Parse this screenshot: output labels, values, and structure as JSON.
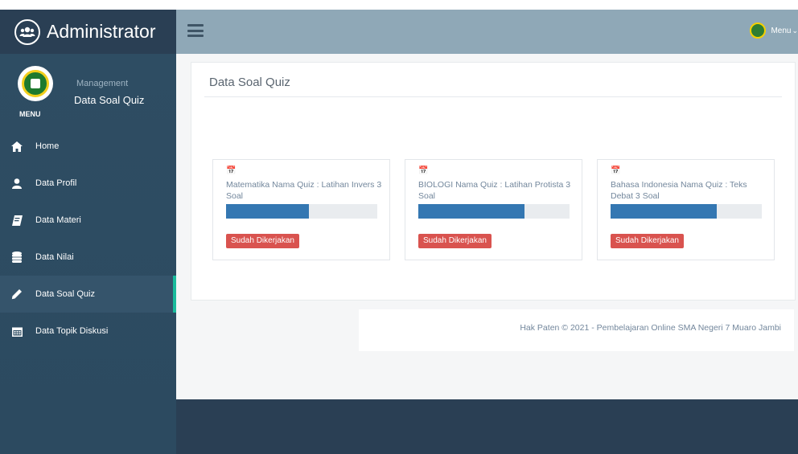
{
  "brand": {
    "title": "Administrator",
    "icon": "users-icon"
  },
  "topbar": {
    "user_menu_label": "Menu",
    "caret": "chevron-down-icon"
  },
  "sidebar": {
    "profile": {
      "subtitle": "Management",
      "name": "Data Soal Quiz",
      "menu_tag": "MENU"
    },
    "items": [
      {
        "label": "Home",
        "icon": "home-icon",
        "active": false
      },
      {
        "label": "Data Profil",
        "icon": "user-icon",
        "active": false
      },
      {
        "label": "Data Materi",
        "icon": "book-icon",
        "active": false
      },
      {
        "label": "Data Nilai",
        "icon": "database-icon",
        "active": false
      },
      {
        "label": "Data Soal Quiz",
        "icon": "pencil-icon",
        "active": true
      },
      {
        "label": "Data Topik Diskusi",
        "icon": "calendar-icon",
        "active": false
      }
    ]
  },
  "main": {
    "title": "Data Soal Quiz",
    "cards": [
      {
        "text": "Matematika Nama Quiz : Latihan Invers 3 Soal",
        "progress": 0.55,
        "button": "Sudah Dikerjakan"
      },
      {
        "text": "BIOLOGI Nama Quiz : Latihan Protista 3 Soal",
        "progress": 0.7,
        "button": "Sudah Dikerjakan"
      },
      {
        "text": "Bahasa Indonesia Nama Quiz : Teks Debat 3 Soal",
        "progress": 0.7,
        "button": "Sudah Dikerjakan"
      }
    ]
  },
  "footer": {
    "text": "Hak Paten © 2021 - Pembelajaran Online SMA Negeri 7 Muaro Jambi"
  },
  "colors": {
    "sidebar": "#2a3f54",
    "topbar": "#8fa8b7",
    "accent": "#1abb9c",
    "progress": "#3477b2",
    "danger": "#d9534f"
  }
}
